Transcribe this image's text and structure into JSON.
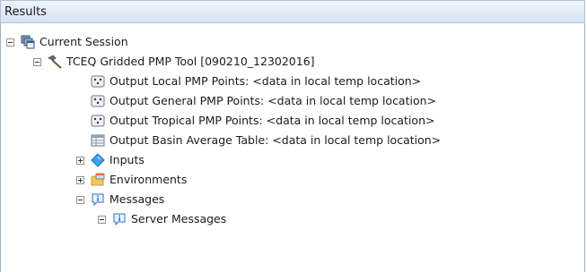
{
  "panel": {
    "title": "Results"
  },
  "tree": {
    "session": "Current Session",
    "tool": "TCEQ Gridded PMP Tool [090210_12302016]",
    "outputs": [
      "Output Local PMP Points: <data in local temp location>",
      "Output General PMP Points: <data in local temp location>",
      "Output Tropical PMP Points: <data in local temp location>",
      "Output Basin Average Table: <data in local temp location>"
    ],
    "inputs": "Inputs",
    "environments": "Environments",
    "messages": "Messages",
    "server_messages": "Server Messages"
  },
  "icons": {
    "session": "stacked-windows-icon",
    "tool": "hammer-icon",
    "points": "point-feature-icon",
    "table": "table-icon",
    "inputs": "blue-diamond-icon",
    "environments": "environments-folder-icon",
    "messages": "info-message-icon"
  }
}
